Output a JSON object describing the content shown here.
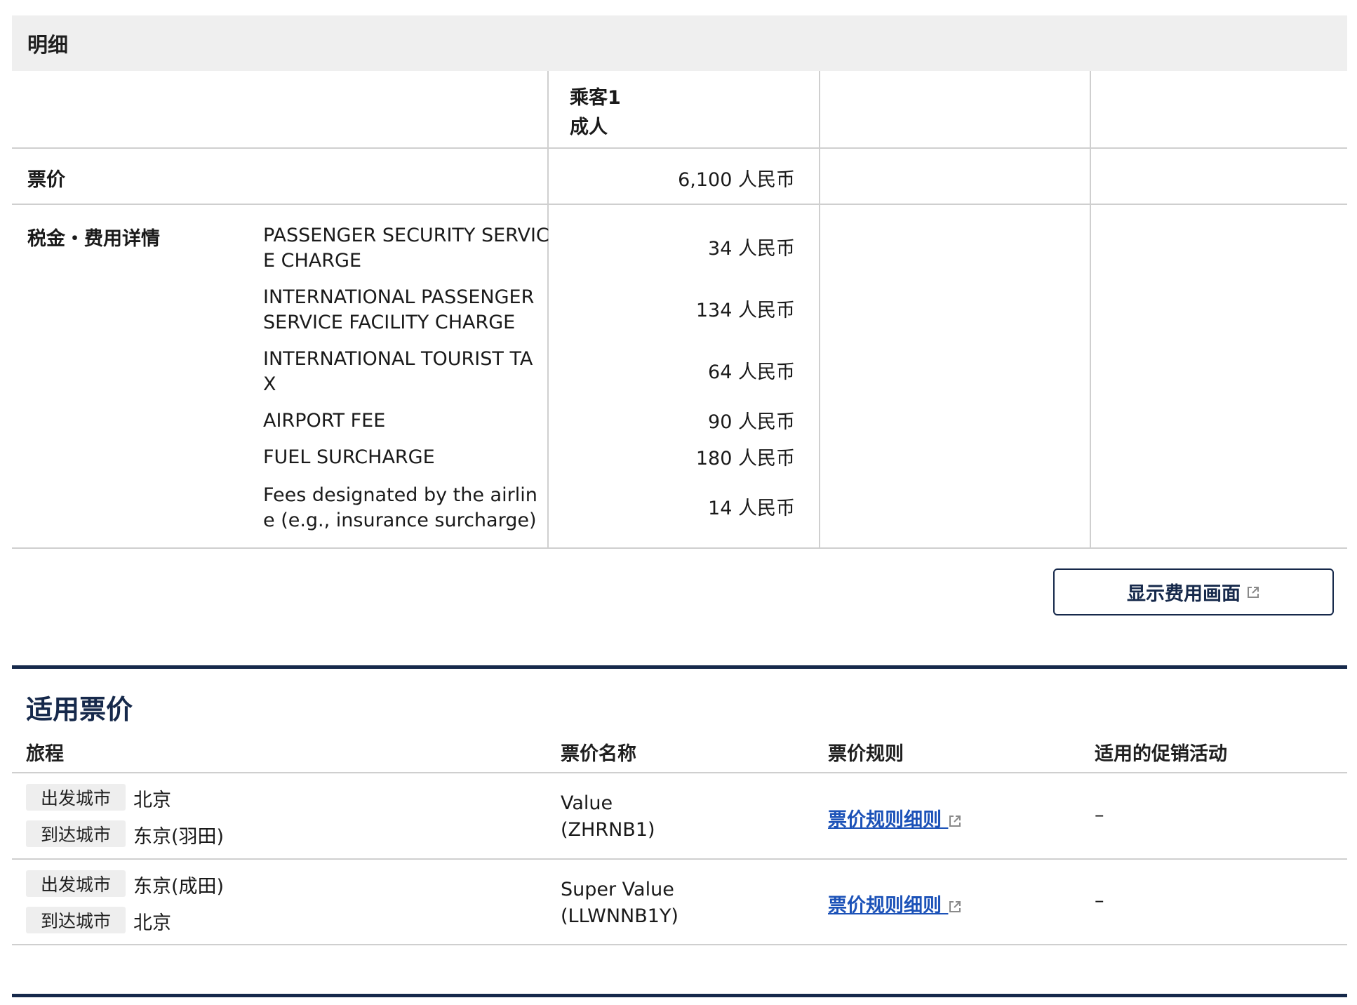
{
  "detail": {
    "header": "明细",
    "passenger_label": "乘客1",
    "passenger_type": "成人",
    "fare_label": "票价",
    "fare_amount": "6,100 人民币",
    "tax_label": "税金・费用详情",
    "taxes": [
      {
        "name_line1": "PASSENGER SECURITY SERVIC",
        "name_line2": "E CHARGE",
        "amount": "34 人民币"
      },
      {
        "name_line1": "INTERNATIONAL PASSENGER",
        "name_line2": "SERVICE FACILITY CHARGE",
        "amount": "134 人民币"
      },
      {
        "name_line1": "INTERNATIONAL TOURIST TA",
        "name_line2": "X",
        "amount": "64 人民币"
      },
      {
        "name_line1": "AIRPORT FEE",
        "name_line2": "",
        "amount": "90 人民币"
      },
      {
        "name_line1": "FUEL SURCHARGE",
        "name_line2": "",
        "amount": "180 人民币"
      },
      {
        "name_line1": "Fees designated by the airlin",
        "name_line2": "e (e.g., insurance surcharge)",
        "amount": "14 人民币"
      }
    ],
    "fee_button_label": "显示费用画面"
  },
  "fares": {
    "title": "适用票价",
    "columns": {
      "itinerary": "旅程",
      "fare_name": "票价名称",
      "fare_rules": "票价规则",
      "promotions": "适用的促销活动"
    },
    "rows": [
      {
        "dep_label": "出发城市",
        "dep_city": "北京",
        "arr_label": "到达城市",
        "arr_city": "东京(羽田)",
        "fare_name": "Value",
        "fare_code": "(ZHRNB1)",
        "rule_link": "票价规则细则",
        "promo": "–"
      },
      {
        "dep_label": "出发城市",
        "dep_city": "东京(成田)",
        "arr_label": "到达城市",
        "arr_city": "北京",
        "fare_name": "Super Value",
        "fare_code": "(LLWNNB1Y)",
        "rule_link": "票价规则细则",
        "promo": "–"
      }
    ]
  }
}
